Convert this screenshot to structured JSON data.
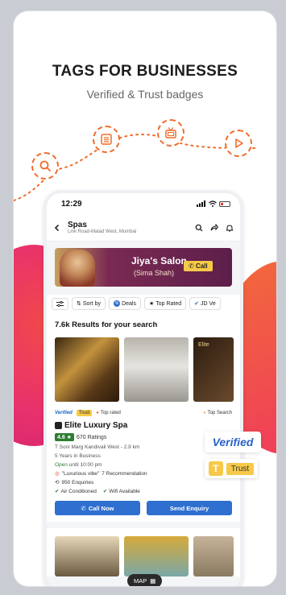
{
  "headline": "TAGS FOR BUSINESSES",
  "subhead": "Verified & Trust badges",
  "status": {
    "time": "12:29"
  },
  "appbar": {
    "title": "Spas",
    "subtitle": "Link Road-Malad West, Mumbai"
  },
  "banner": {
    "name": "Jiya's Salon",
    "owner": "(Sima Shah)",
    "call": "Call"
  },
  "filters": [
    "Sort by",
    "Deals",
    "Top Rated",
    "JD Ve"
  ],
  "results_title": "7.6k Results for your search",
  "photo3_text": "Elite",
  "listing": {
    "tag_verified": "Verified",
    "tag_trust": "Trust",
    "tag_top": "Top rated",
    "tag_search": "Top Search",
    "name": "Elite Luxury Spa",
    "rating": "4.6",
    "ratings_count": "670 Ratings",
    "address": "T Soni Marg Kandivali West - 2.9 km",
    "years": "5 Years in Business",
    "open": "Open",
    "open_until": "until 10:00 pm",
    "vibe": "\"Luxurious vibe\"",
    "vibe_rec": "7 Recommendation",
    "enquiries": "950 Enquiries",
    "amenity1": "Air Conditioned",
    "amenity2": "Wifi Available",
    "btn_call": "Call Now",
    "btn_enquiry": "Send Enquiry"
  },
  "map_label": "MAP",
  "float_verified": "Verified",
  "float_trust": "Trust",
  "colors": {
    "accent": "#f06c2a",
    "primary_button": "#2f6fd0",
    "rating": "#2e7d32",
    "trust": "#f7c948"
  }
}
